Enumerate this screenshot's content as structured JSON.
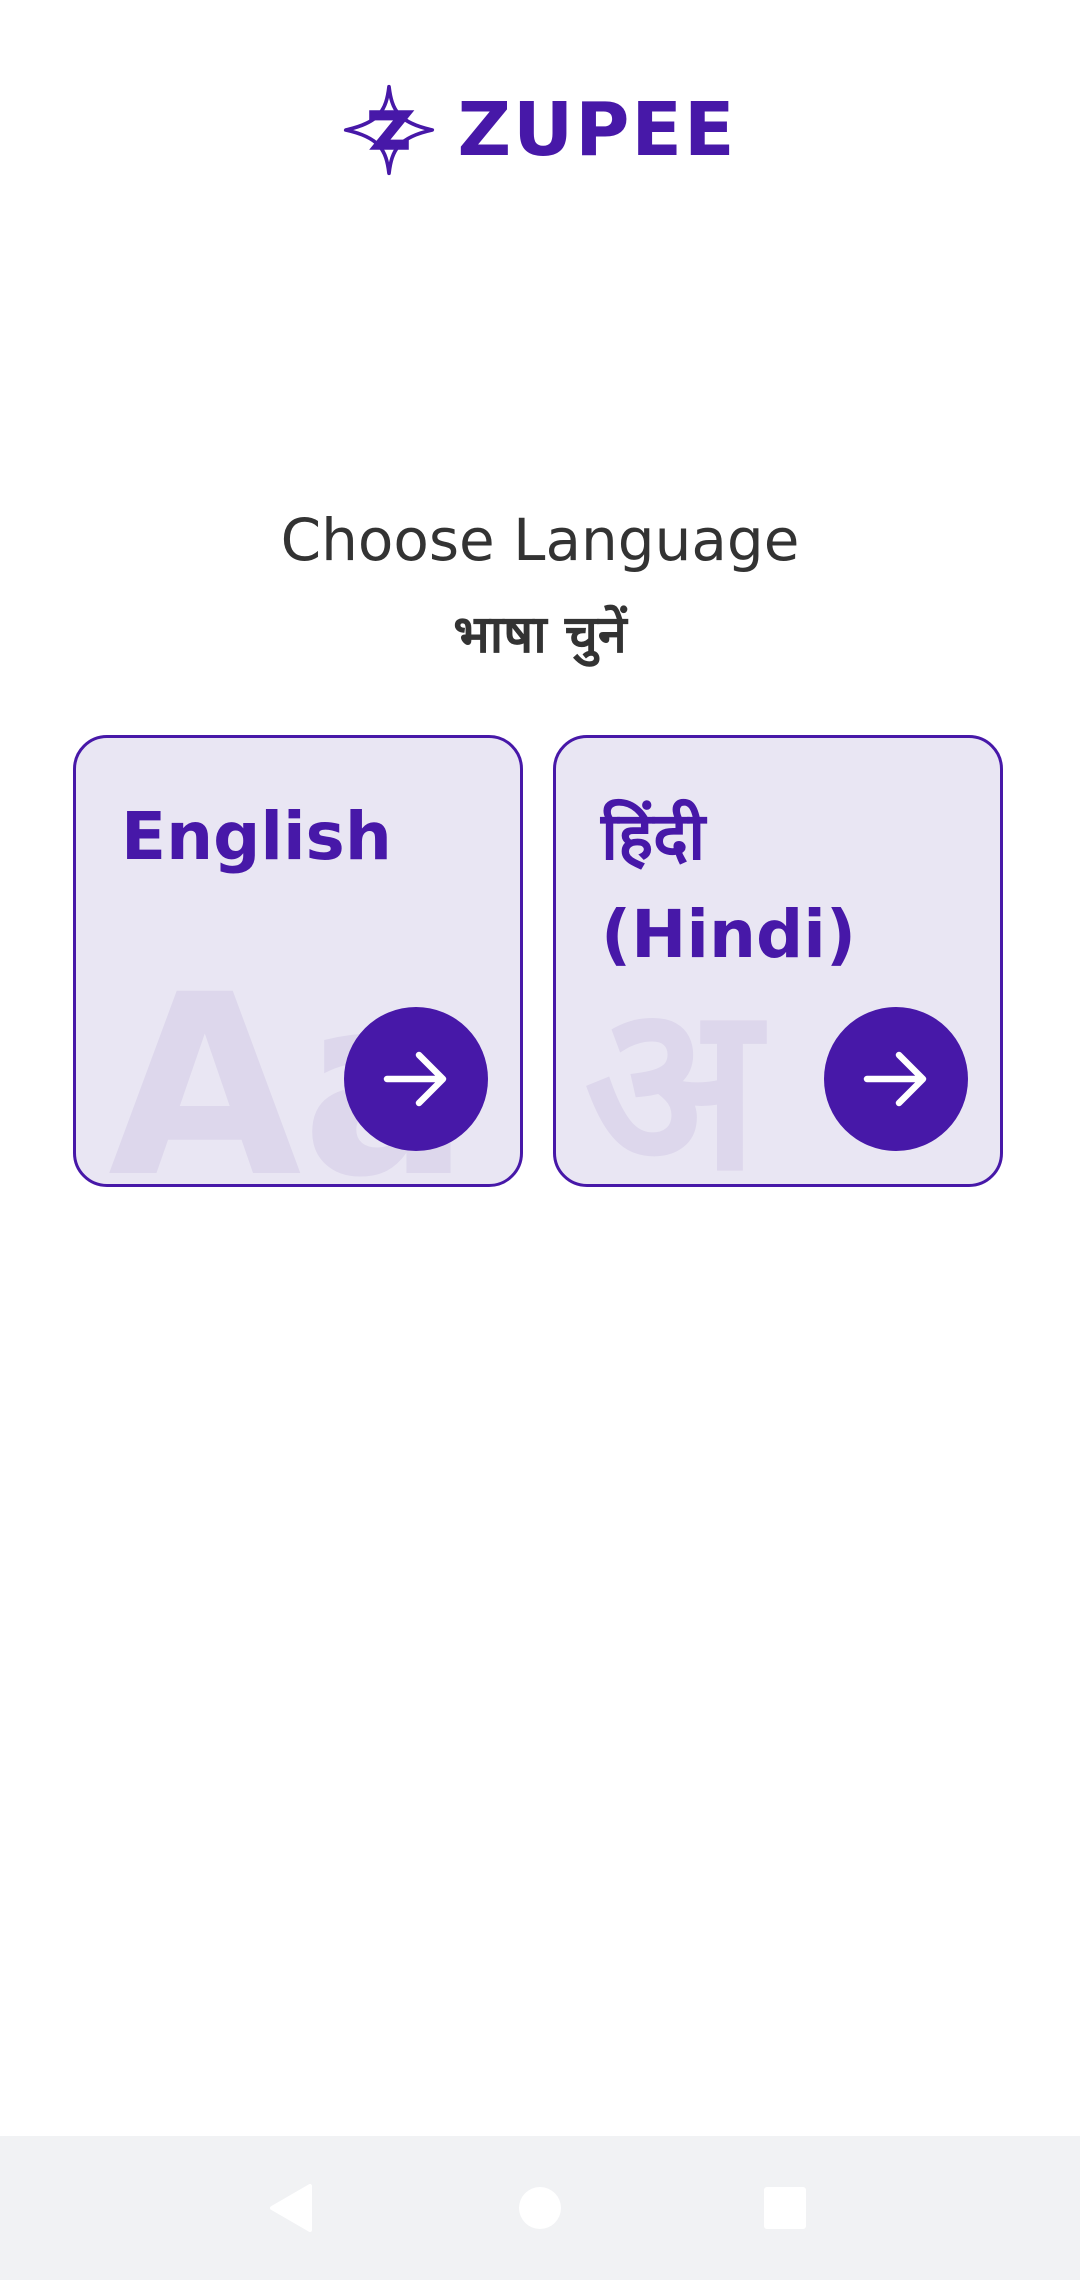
{
  "brand": {
    "name": "ZUPEE",
    "color": "#4718a8",
    "logo_icon": "zupee-star-z-icon"
  },
  "heading": {
    "title": "Choose Language",
    "subtitle": "भाषा चुनें"
  },
  "languages": [
    {
      "label": "English",
      "watermark": "Aa",
      "action_icon": "arrow-right-icon"
    },
    {
      "label": "हिंदी\n(Hindi)",
      "watermark": "अ",
      "action_icon": "arrow-right-icon"
    }
  ],
  "colors": {
    "accent": "#4718a8",
    "card_background": "#e9e6f3",
    "text": "#333333",
    "navbar_background": "#f1f2f4"
  },
  "navigation_bar": {
    "buttons": [
      "back-triangle-icon",
      "home-circle-icon",
      "recents-square-icon"
    ]
  }
}
